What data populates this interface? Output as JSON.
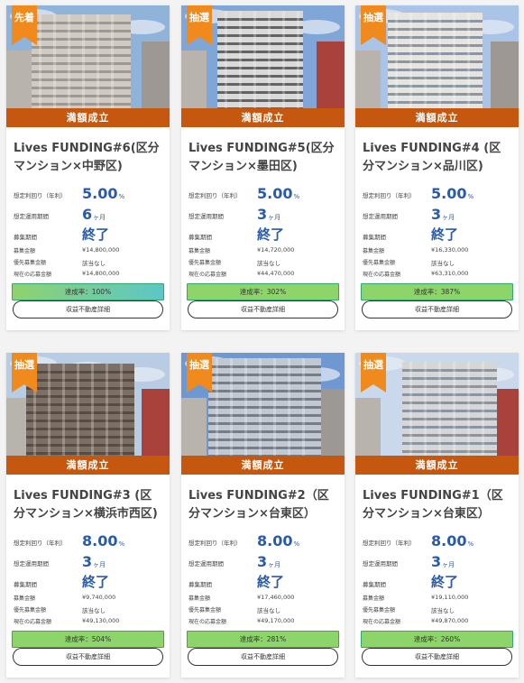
{
  "banner_label": "満額成立",
  "labels": {
    "yield": "想定利回り（年利）",
    "period": "想定運用期間",
    "recruit": "募集期間",
    "amount": "募集金額",
    "priority": "優先募集金額",
    "applied": "現在の応募金額"
  },
  "units": {
    "percent": "%",
    "month": "ヶ月"
  },
  "colors": {
    "accent": "#c6570f",
    "value": "#2b5ba8",
    "progress_border": "#2fa96a"
  },
  "cards": [
    {
      "tag": "先着",
      "title": "Lives FUNDING#6(区分マンション×中野区)",
      "yield": "5.00",
      "period": "6",
      "recruit": "終了",
      "amount": "¥14,800,000",
      "priority": "該当なし",
      "applied": "¥14,800,000",
      "progress_text": "達成率：100%",
      "progress_percent": 100,
      "button": "収益不動産詳細"
    },
    {
      "tag": "抽選",
      "title": "Lives FUNDING#5(区分マンション×墨田区)",
      "yield": "5.00",
      "period": "3",
      "recruit": "終了",
      "amount": "¥14,720,000",
      "priority": "該当なし",
      "applied": "¥44,470,000",
      "progress_text": "達成率：302%",
      "progress_percent": 302,
      "button": "収益不動産詳細"
    },
    {
      "tag": "抽選",
      "title": "Lives FUNDING#4 (区分マンション×品川区)",
      "yield": "5.00",
      "period": "3",
      "recruit": "終了",
      "amount": "¥16,330,000",
      "priority": "該当なし",
      "applied": "¥63,310,000",
      "progress_text": "達成率：387%",
      "progress_percent": 387,
      "button": "収益不動産詳細"
    },
    {
      "tag": "抽選",
      "title": "Lives FUNDING#3 (区分マンション×横浜市西区)",
      "yield": "8.00",
      "period": "3",
      "recruit": "終了",
      "amount": "¥9,740,000",
      "priority": "該当なし",
      "applied": "¥49,130,000",
      "progress_text": "達成率：504%",
      "progress_percent": 504,
      "button": "収益不動産詳細"
    },
    {
      "tag": "抽選",
      "title": "Lives FUNDING#2（区分マンション×台東区）",
      "yield": "8.00",
      "period": "3",
      "recruit": "終了",
      "amount": "¥17,460,000",
      "priority": "該当なし",
      "applied": "¥49,170,000",
      "progress_text": "達成率：281%",
      "progress_percent": 281,
      "button": "収益不動産詳細"
    },
    {
      "tag": "抽選",
      "title": "Lives FUNDING#1（区分マンション×台東区）",
      "yield": "8.00",
      "period": "3",
      "recruit": "終了",
      "amount": "¥19,110,000",
      "priority": "該当なし",
      "applied": "¥49,870,000",
      "progress_text": "達成率：260%",
      "progress_percent": 260,
      "button": "収益不動産詳細"
    }
  ]
}
